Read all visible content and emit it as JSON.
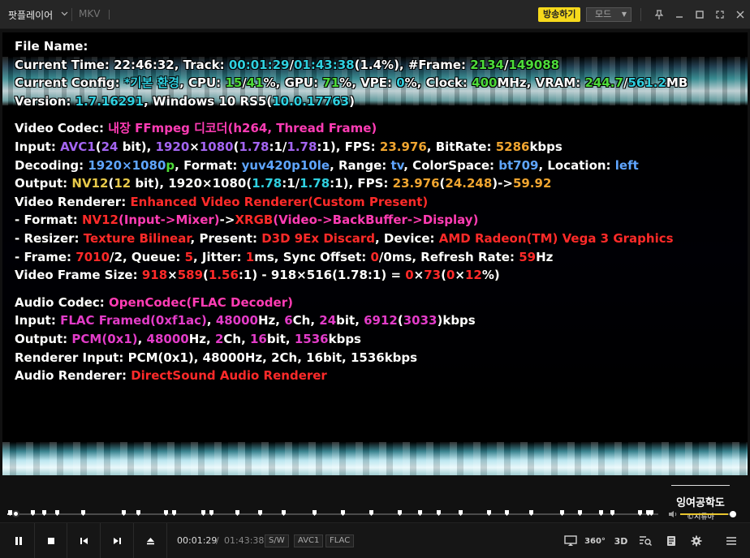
{
  "titlebar": {
    "app_menu_label": "팟플레이어",
    "file_type": "MKV",
    "broadcast_label": "방송하기",
    "mode_label": "모드"
  },
  "osd": {
    "file_name_label": "File Name:",
    "current_time": {
      "label": "Current Time: ",
      "clock": "22:46:32",
      "track_label": ", Track: ",
      "track_pos": "00:01:29",
      "slash": "/",
      "track_total": "01:43:38",
      "percent": "(1.4%)",
      "frame_label": ", #Frame: ",
      "frame_cur": "2134",
      "frame_total": "149088"
    },
    "current_config": {
      "label": "Current Config: ",
      "profile": "*기본 환경",
      "cpu_label": ", CPU: ",
      "cpu_a": "15",
      "cpu_b": "41",
      "gpu_label": "%, GPU: ",
      "gpu": "71",
      "vpe_label": "%, VPE: ",
      "vpe": "0",
      "clock_label": "%, Clock: ",
      "clock": "400",
      "vram_label": "MHz, VRAM: ",
      "vram_a": "244.7",
      "vram_b": "561.2",
      "vram_unit": "MB"
    },
    "version": {
      "label": "Version: ",
      "ver": "1.7.16291",
      "os_label": ", Windows 10 RS5(",
      "os_build": "10.0.17763",
      "close": ")"
    },
    "video_codec": {
      "label": "Video Codec: ",
      "value": "내장 FFmpeg 디코더(h264, Thread Frame)"
    },
    "video_input": {
      "label": "Input: ",
      "codec": "AVC1",
      "bits": "24",
      "res_w": "1920",
      "res_h": "1080",
      "ar1": "1.78",
      "ar2": "1.78",
      "fps": "23.976",
      "bitrate": "5286",
      "bitrate_unit": "kbps"
    },
    "decoding": {
      "label": "Decoding: ",
      "res": "1920×1080",
      "scan": "p",
      "format": "yuv420p10le",
      "range": "tv",
      "colorspace": "bt709",
      "location": "left"
    },
    "video_output": {
      "label": "Output: ",
      "fmt": "NV12",
      "bits": "12",
      "res": "1920×1080",
      "ar1": "1.78",
      "ar2": "1.78",
      "fps_a": "23.976",
      "fps_b": "24.248",
      "fps_out": "59.92"
    },
    "video_renderer": {
      "label": "Video Renderer: ",
      "value": "Enhanced Video Renderer(Custom Present)"
    },
    "vr_format": {
      "label": " - Format: ",
      "in": "NV12",
      "in_path": "(Input->Mixer)",
      "arrow": "->",
      "out": "XRGB",
      "out_path": "(Video->BackBuffer->Display)"
    },
    "vr_resizer": {
      "label": " - Resizer: ",
      "resizer": "Texture Bilinear",
      "present_label": ", Present: ",
      "present": "D3D 9Ex Discard",
      "device_label": ", Device: ",
      "device": "AMD Radeon(TM) Vega 3 Graphics"
    },
    "vr_frame": {
      "label": " - Frame: ",
      "frame": "7010",
      "frame_div": "2",
      "queue": "5",
      "jitter": "1",
      "sync": "0",
      "sync_b": "0",
      "refresh": "59",
      "refresh_unit": "Hz"
    },
    "frame_size": {
      "label": "Video Frame Size: ",
      "w1": "918",
      "h1": "589",
      "ar1": "1.56",
      "rest": " - 918×516(1.78:1) = ",
      "d1": "0",
      "d2": "73",
      "d3": "0",
      "d4": "12"
    },
    "audio_codec": {
      "label": "Audio Codec: ",
      "value": "OpenCodec(FLAC Decoder)"
    },
    "audio_input": {
      "label": "Input: ",
      "fmt": "FLAC Framed",
      "tag": "(0xf1ac)",
      "hz": "48000",
      "ch": "6",
      "bit": "24",
      "kbps_a": "6912",
      "kbps_b": "3033"
    },
    "audio_output": {
      "label": "Output: ",
      "fmt": "PCM",
      "tag": "(0x1)",
      "hz": "48000",
      "ch": "2",
      "bit": "16",
      "kbps": "1536"
    },
    "renderer_input": "Renderer Input: PCM(0x1), 48000Hz, 2Ch, 16bit, 1536kbps",
    "audio_renderer": {
      "label": "Audio Renderer: ",
      "value": "DirectSound Audio Renderer"
    }
  },
  "watermark": {
    "line1": "잉여공학도",
    "line2": "©시튜아"
  },
  "seek": {
    "progress_percent": 1.4
  },
  "volume": {
    "level_percent": 92
  },
  "controls": {
    "current_time": "00:01:29",
    "separator": "/",
    "total_time": "01:43:38",
    "badges": [
      "S/W",
      "AVC1",
      "FLAC"
    ],
    "label_360": "360°",
    "label_3d": "3D"
  }
}
